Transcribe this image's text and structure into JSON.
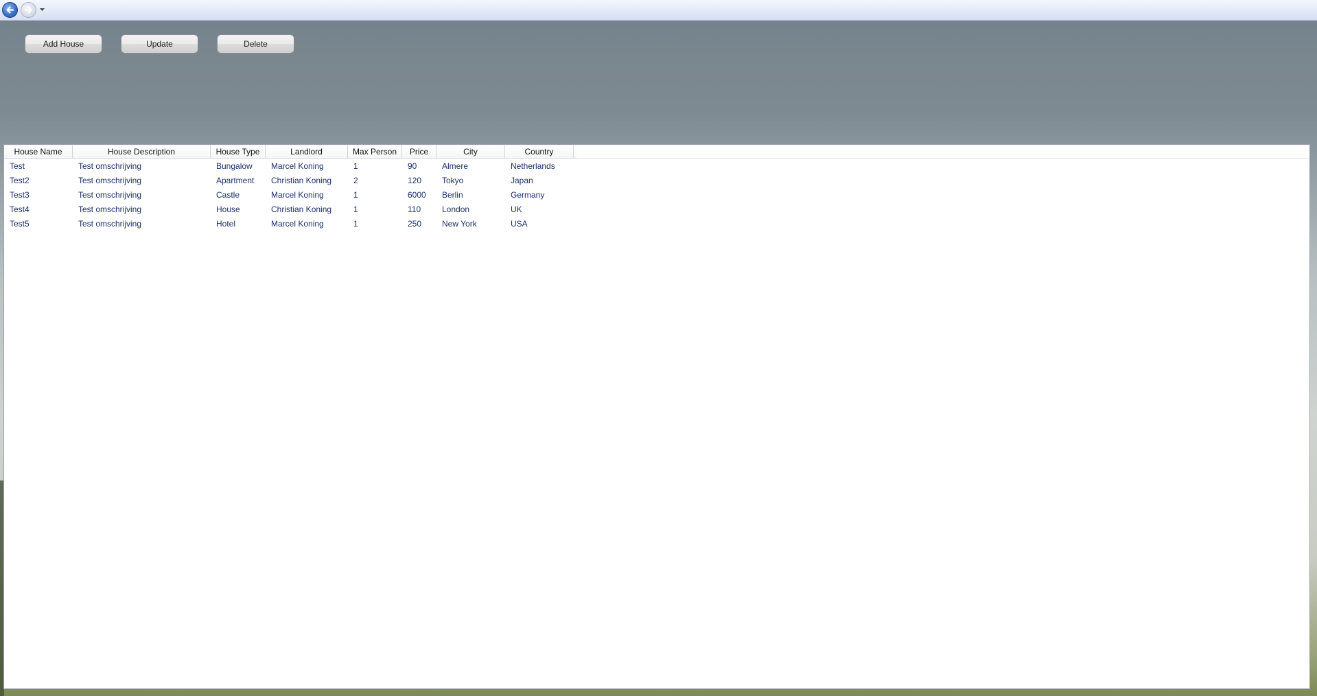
{
  "navigation": {
    "back_icon": "back-arrow-icon",
    "forward_icon": "forward-arrow-icon",
    "dropdown_icon": "chevron-down-icon"
  },
  "toolbar": {
    "add_label": "Add House",
    "update_label": "Update",
    "delete_label": "Delete"
  },
  "grid": {
    "columns": [
      "House Name",
      "House Description",
      "House Type",
      "Landlord",
      "Max Person",
      "Price",
      "City",
      "Country"
    ],
    "rows": [
      [
        "Test",
        "Test omschrijving",
        "Bungalow",
        "Marcel Koning",
        "1",
        "90",
        "Almere",
        "Netherlands"
      ],
      [
        "Test2",
        "Test omschrijving",
        "Apartment",
        "Christian Koning",
        "2",
        "120",
        "Tokyo",
        "Japan"
      ],
      [
        "Test3",
        "Test omschrijving",
        "Castle",
        "Marcel Koning",
        "1",
        "6000",
        "Berlin",
        "Germany"
      ],
      [
        "Test4",
        "Test omschrijving",
        "House",
        "Christian Koning",
        "1",
        "110",
        "London",
        "UK"
      ],
      [
        "Test5",
        "Test omschrijving",
        "Hotel",
        "Marcel Koning",
        "1",
        "250",
        "New York",
        "USA"
      ]
    ]
  },
  "colors": {
    "cell_text": "#1c2f6b",
    "header_text": "#111111"
  }
}
